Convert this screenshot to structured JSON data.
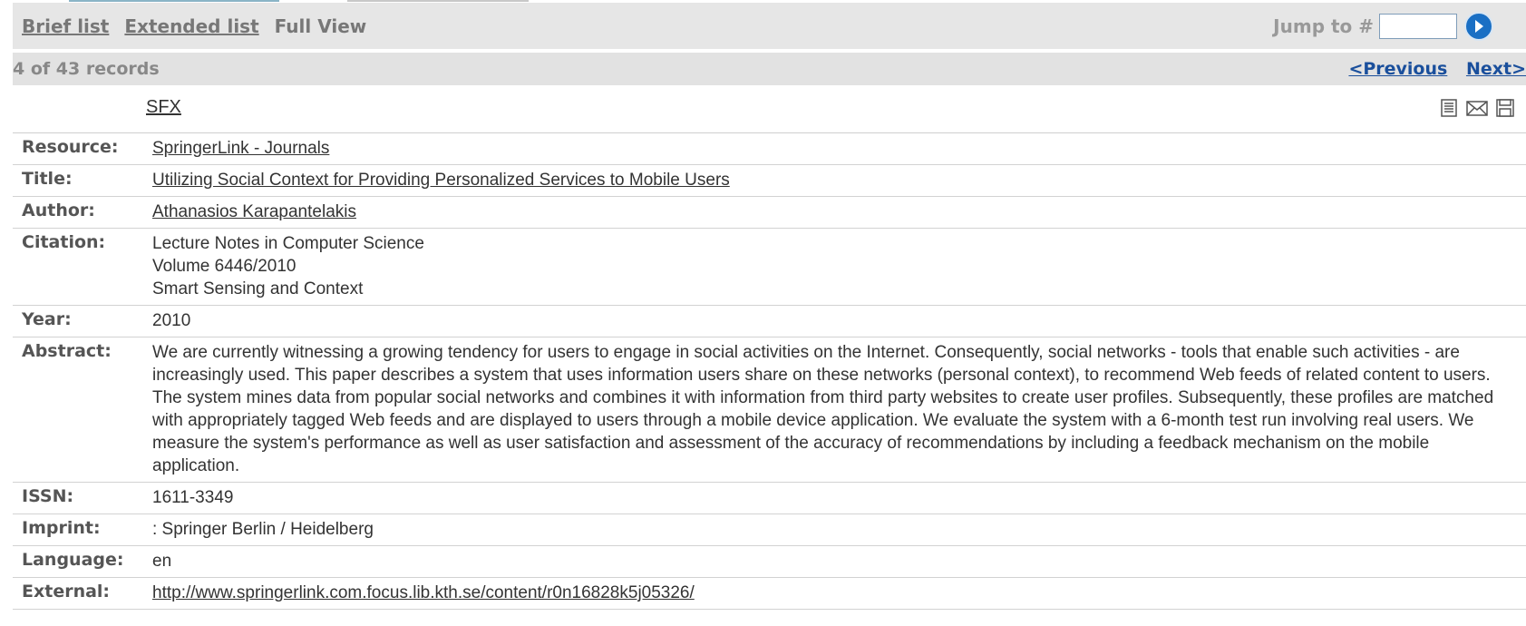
{
  "nav": {
    "brief_list": "Brief list",
    "extended_list": "Extended list",
    "full_view": "Full View",
    "jump_label": "Jump to #",
    "jump_value": ""
  },
  "records": {
    "count_text": "4 of 43 records",
    "previous": "<Previous",
    "next": "Next>"
  },
  "sfx_label": "SFX",
  "fields": {
    "resource": {
      "label": "Resource:",
      "value": "SpringerLink - Journals"
    },
    "title": {
      "label": "Title:",
      "value": "Utilizing Social Context for Providing Personalized Services to Mobile Users"
    },
    "author": {
      "label": "Author:",
      "value": "Athanasios Karapantelakis"
    },
    "citation": {
      "label": "Citation:",
      "lines": [
        "Lecture Notes in Computer Science",
        "Volume 6446/2010",
        "Smart Sensing and Context"
      ]
    },
    "year": {
      "label": "Year:",
      "value": "2010"
    },
    "abstract": {
      "label": "Abstract:",
      "value": "We are currently witnessing a growing tendency for users to engage in social activities on the Internet. Consequently, social networks - tools that enable such activities - are increasingly used. This paper describes a system that uses information users share on these networks (personal context), to recommend Web feeds of related content to users. The system mines data from popular social networks and combines it with information from third party websites to create user profiles. Subsequently, these profiles are matched with appropriately tagged Web feeds and are displayed to users through a mobile device application. We evaluate the system with a 6-month test run involving real users. We measure the system's performance as well as user satisfaction and assessment of the accuracy of recommendations by including a feedback mechanism on the mobile application."
    },
    "issn": {
      "label": "ISSN:",
      "value": "1611-3349"
    },
    "imprint": {
      "label": "Imprint:",
      "value": ": Springer Berlin / Heidelberg"
    },
    "language": {
      "label": "Language:",
      "value": "en"
    },
    "external": {
      "label": "External:",
      "value": "http://www.springerlink.com.focus.lib.kth.se/content/r0n16828k5j05326/"
    }
  },
  "icons": [
    "record-icon",
    "mail-icon",
    "save-icon",
    "go-arrow-icon"
  ],
  "colors": {
    "link_blue": "#1a4f9c",
    "bar_gray": "#e6e6e6",
    "go_button": "#1a6fc4"
  }
}
